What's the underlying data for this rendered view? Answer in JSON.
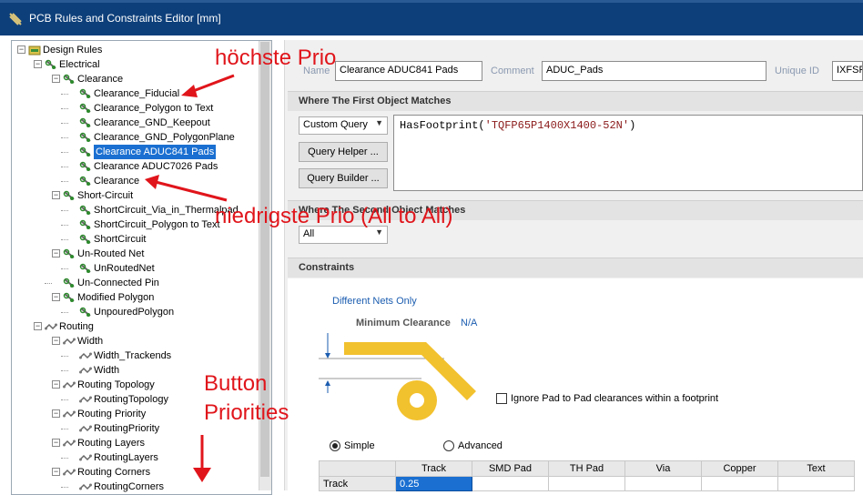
{
  "window": {
    "title": "PCB Rules and Constraints Editor [mm]"
  },
  "tree": {
    "root": "Design Rules",
    "electrical": "Electrical",
    "clearance": "Clearance",
    "clearance_items": [
      "Clearance_Fiducial",
      "Clearance_Polygon to Text",
      "Clearance_GND_Keepout",
      "Clearance_GND_PolygonPlane",
      "Clearance ADUC841 Pads",
      "Clearance ADUC7026 Pads",
      "Clearance"
    ],
    "short_circuit": "Short-Circuit",
    "short_circuit_items": [
      "ShortCircuit_Via_in_Thermalpad",
      "ShortCircuit_Polygon to Text",
      "ShortCircuit"
    ],
    "unrouted_net": "Un-Routed Net",
    "unrouted_items": [
      "UnRoutedNet"
    ],
    "unconnected_pin": "Un-Connected Pin",
    "modified_polygon": "Modified Polygon",
    "modified_polygon_items": [
      "UnpouredPolygon"
    ],
    "routing": "Routing",
    "width": "Width",
    "width_items": [
      "Width_Trackends",
      "Width"
    ],
    "routing_topology": "Routing Topology",
    "routing_topology_items": [
      "RoutingTopology"
    ],
    "routing_priority": "Routing Priority",
    "routing_priority_items": [
      "RoutingPriority"
    ],
    "routing_layers": "Routing Layers",
    "routing_layers_items": [
      "RoutingLayers"
    ],
    "routing_corners": "Routing Corners",
    "routing_corners_items": [
      "RoutingCorners"
    ]
  },
  "rule": {
    "name_label": "Name",
    "name_value": "Clearance ADUC841 Pads",
    "comment_label": "Comment",
    "comment_value": "ADUC_Pads",
    "uid_label": "Unique ID",
    "uid_value": "IXFSPK"
  },
  "first_match": {
    "header": "Where The First Object Matches",
    "query_type": "Custom Query",
    "query_helper": "Query Helper ...",
    "query_builder": "Query Builder ...",
    "query_fn": "HasFootprint(",
    "query_arg": "'TQFP65P1400X1400-52N'",
    "query_end": ")"
  },
  "second_match": {
    "header": "Where The Second Object Matches",
    "query_type": "All"
  },
  "constraints": {
    "header": "Constraints",
    "different_nets": "Different Nets Only",
    "min_clearance_label": "Minimum Clearance",
    "min_clearance_value": "N/A",
    "ignore_pad": "Ignore Pad to Pad clearances within a footprint",
    "mode_simple": "Simple",
    "mode_advanced": "Advanced",
    "selected_mode": "Simple",
    "columns": [
      "Track",
      "SMD Pad",
      "TH Pad",
      "Via",
      "Copper",
      "Text"
    ],
    "row_label": "Track",
    "row_values": [
      "0.25",
      "",
      "",
      "",
      "",
      ""
    ]
  },
  "annotations": {
    "highest": "höchste Prio",
    "lowest": "niedrigste Prio (All to All)",
    "button": "Button",
    "priorities": "Priorities"
  },
  "colors": {
    "title_bar": "#0d3f7a",
    "selection": "#1a6fd1",
    "annotation": "#e0151b",
    "pad": "#f2c12e"
  }
}
